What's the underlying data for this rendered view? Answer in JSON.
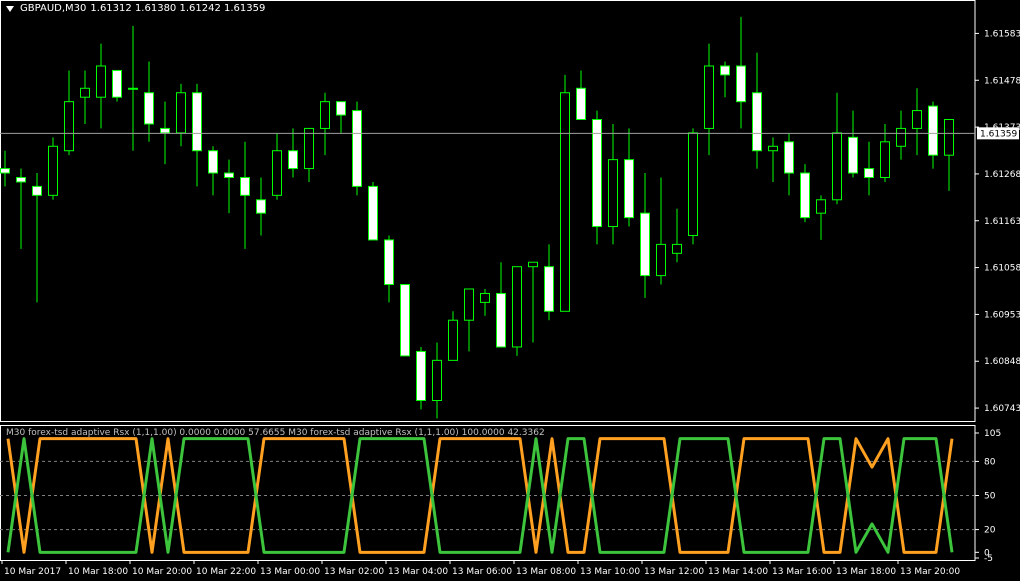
{
  "colors": {
    "background": "#000000",
    "foreground": "#ffffff",
    "bull_body": "#000000",
    "bear_body": "#ffffff",
    "wick": "#00ff00",
    "bid_line": "#a0a0a0",
    "grid": "#808080",
    "rsx_up": "#3cc43c",
    "rsx_down": "#ffa020"
  },
  "main_chart": {
    "symbol_timeframe": "GBPAUD,M30",
    "ohlc": "1.61312 1.61380 1.61242 1.61359",
    "current_price_label": "1.61359",
    "price_labels": [
      "1.61583",
      "1.61478",
      "1.61373",
      "1.61268",
      "1.61163",
      "1.61058",
      "1.60953",
      "1.60848",
      "1.60743",
      "1.61268",
      "1.61163"
    ],
    "price_axis": [
      "1.61583",
      "1.61478",
      "1.61373",
      "1.61268",
      "1.61163",
      "1.61058",
      "1.60953",
      "1.60848",
      "1.60743"
    ]
  },
  "indicator": {
    "title": "M30 forex-tsd adaptive Rsx (1,1,1.00) 0.0000 0.0000 57.6655  M30 forex-tsd adaptive Rsx (1,1,1.00) 100.0000 42.3362",
    "levels": [
      "105",
      "80",
      "50",
      "20",
      "0",
      "-5"
    ],
    "axis_labels": [
      "105",
      "80",
      "50",
      "20",
      "0",
      "-5"
    ]
  },
  "time_axis": [
    "10 Mar 2017",
    "10 Mar 18:00",
    "10 Mar 20:00",
    "10 Mar 22:00",
    "13 Mar 00:00",
    "13 Mar 02:00",
    "13 Mar 04:00",
    "13 Mar 06:00",
    "13 Mar 08:00",
    "13 Mar 10:00",
    "13 Mar 12:00",
    "13 Mar 14:00",
    "13 Mar 16:00",
    "13 Mar 18:00",
    "13 Mar 20:00"
  ],
  "chart_data": {
    "type": "candlestick",
    "price_range": [
      1.60723,
      1.6164
    ],
    "candles": [
      [
        1.6128,
        1.6132,
        1.6124,
        1.6127
      ],
      [
        1.6126,
        1.6128,
        1.611,
        1.6125
      ],
      [
        1.6124,
        1.6127,
        1.6098,
        1.6122
      ],
      [
        1.6122,
        1.6135,
        1.6121,
        1.6133
      ],
      [
        1.6132,
        1.615,
        1.6131,
        1.6143
      ],
      [
        1.6144,
        1.615,
        1.6138,
        1.6146
      ],
      [
        1.6144,
        1.6156,
        1.6137,
        1.6151
      ],
      [
        1.615,
        1.615,
        1.6143,
        1.6144
      ],
      [
        1.6146,
        1.616,
        1.6132,
        1.6146
      ],
      [
        1.6145,
        1.6152,
        1.6134,
        1.6138
      ],
      [
        1.6137,
        1.6143,
        1.6129,
        1.6136
      ],
      [
        1.6136,
        1.6147,
        1.6133,
        1.6145
      ],
      [
        1.6145,
        1.6147,
        1.6124,
        1.6132
      ],
      [
        1.6132,
        1.6133,
        1.6122,
        1.6127
      ],
      [
        1.6127,
        1.613,
        1.6118,
        1.6126
      ],
      [
        1.6126,
        1.6134,
        1.611,
        1.6122
      ],
      [
        1.6121,
        1.6126,
        1.6113,
        1.6118
      ],
      [
        1.6122,
        1.6136,
        1.6121,
        1.6132
      ],
      [
        1.6132,
        1.6137,
        1.6126,
        1.6128
      ],
      [
        1.6128,
        1.6137,
        1.6125,
        1.6137
      ],
      [
        1.6137,
        1.6145,
        1.6131,
        1.6143
      ],
      [
        1.6143,
        1.6143,
        1.6136,
        1.614
      ],
      [
        1.6141,
        1.6143,
        1.6122,
        1.6124
      ],
      [
        1.6124,
        1.6125,
        1.6112,
        1.6112
      ],
      [
        1.6112,
        1.6113,
        1.6098,
        1.6102
      ],
      [
        1.6102,
        1.6102,
        1.6086,
        1.6086
      ],
      [
        1.6087,
        1.6088,
        1.6074,
        1.6076
      ],
      [
        1.6076,
        1.6089,
        1.6072,
        1.6085
      ],
      [
        1.6085,
        1.6096,
        1.6085,
        1.6094
      ],
      [
        1.6094,
        1.6101,
        1.6087,
        1.6101
      ],
      [
        1.6098,
        1.6101,
        1.6095,
        1.61
      ],
      [
        1.61,
        1.6107,
        1.6088,
        1.6088
      ],
      [
        1.6088,
        1.6106,
        1.6086,
        1.6106
      ],
      [
        1.6106,
        1.6107,
        1.6089,
        1.6107
      ],
      [
        1.6106,
        1.6111,
        1.6094,
        1.6096
      ],
      [
        1.6096,
        1.6149,
        1.6096,
        1.6145
      ],
      [
        1.6146,
        1.615,
        1.6139,
        1.6139
      ],
      [
        1.6139,
        1.6141,
        1.6111,
        1.6115
      ],
      [
        1.6115,
        1.6138,
        1.6111,
        1.613
      ],
      [
        1.613,
        1.6137,
        1.6115,
        1.6117
      ],
      [
        1.6118,
        1.6127,
        1.6099,
        1.6104
      ],
      [
        1.6104,
        1.6126,
        1.6102,
        1.6111
      ],
      [
        1.6109,
        1.6119,
        1.6107,
        1.6111
      ],
      [
        1.6113,
        1.6137,
        1.6111,
        1.6136
      ],
      [
        1.6137,
        1.6156,
        1.6131,
        1.6151
      ],
      [
        1.6151,
        1.6152,
        1.6144,
        1.6149
      ],
      [
        1.6151,
        1.6162,
        1.6137,
        1.6143
      ],
      [
        1.6145,
        1.6154,
        1.6128,
        1.6132
      ],
      [
        1.6132,
        1.6135,
        1.6125,
        1.6133
      ],
      [
        1.6134,
        1.6136,
        1.6122,
        1.6127
      ],
      [
        1.6127,
        1.6129,
        1.6116,
        1.6117
      ],
      [
        1.6118,
        1.6122,
        1.6112,
        1.6121
      ],
      [
        1.6121,
        1.6145,
        1.612,
        1.6136
      ],
      [
        1.6135,
        1.6141,
        1.6126,
        1.6127
      ],
      [
        1.6128,
        1.6134,
        1.6122,
        1.6126
      ],
      [
        1.6126,
        1.6138,
        1.6125,
        1.6134
      ],
      [
        1.6133,
        1.6141,
        1.613,
        1.6137
      ],
      [
        1.6137,
        1.6146,
        1.6131,
        1.6141
      ],
      [
        1.6142,
        1.6143,
        1.6128,
        1.6131
      ],
      [
        1.6131,
        1.6139,
        1.6123,
        1.6139
      ]
    ],
    "rsx_green": [
      0,
      100,
      0,
      0,
      0,
      0,
      0,
      0,
      0,
      100,
      0,
      100,
      100,
      100,
      100,
      100,
      0,
      0,
      0,
      0,
      0,
      0,
      100,
      100,
      100,
      100,
      100,
      0,
      0,
      0,
      0,
      0,
      0,
      100,
      0,
      100,
      100,
      0,
      0,
      0,
      0,
      0,
      100,
      100,
      100,
      100,
      0,
      0,
      0,
      0,
      0,
      100,
      100,
      0,
      25,
      0,
      100,
      100,
      100,
      0
    ],
    "rsx_orange": [
      100,
      0,
      100,
      100,
      100,
      100,
      100,
      100,
      100,
      0,
      100,
      0,
      0,
      0,
      0,
      0,
      100,
      100,
      100,
      100,
      100,
      100,
      0,
      0,
      0,
      0,
      0,
      100,
      100,
      100,
      100,
      100,
      100,
      0,
      100,
      0,
      0,
      100,
      100,
      100,
      100,
      100,
      0,
      0,
      0,
      0,
      100,
      100,
      100,
      100,
      100,
      0,
      0,
      100,
      75,
      100,
      0,
      0,
      0,
      100
    ]
  }
}
